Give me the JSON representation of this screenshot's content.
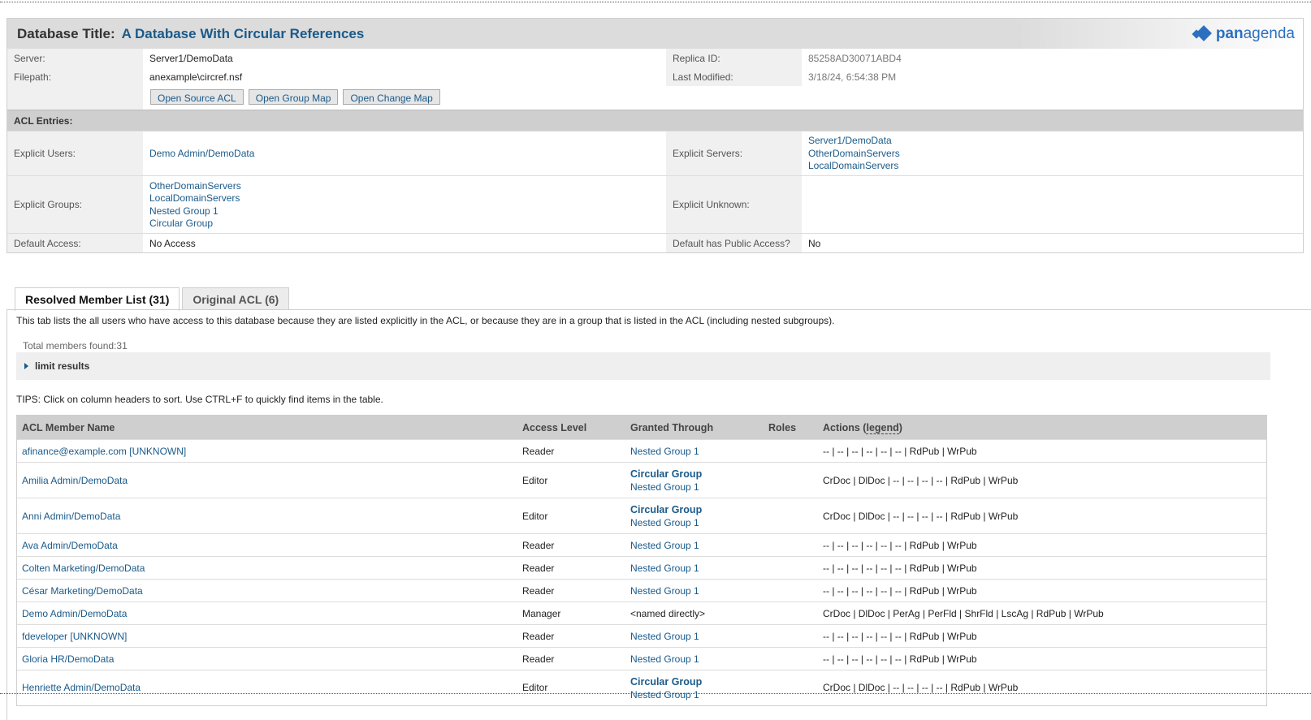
{
  "header": {
    "title_label": "Database Title:",
    "title_value": "A Database With Circular References",
    "logo_bold": "pan",
    "logo_light": "agenda"
  },
  "info": {
    "server_label": "Server:",
    "server_value": "Server1/DemoData",
    "filepath_label": "Filepath:",
    "filepath_value": "anexample\\circref.nsf",
    "replica_label": "Replica ID:",
    "replica_value": "85258AD30071ABD4",
    "modified_label": "Last Modified:",
    "modified_value": "3/18/24, 6:54:38 PM"
  },
  "buttons": {
    "open_source_acl": "Open Source ACL",
    "open_group_map": "Open Group Map",
    "open_change_map": "Open Change Map"
  },
  "acl": {
    "header": "ACL Entries:",
    "explicit_users_label": "Explicit Users:",
    "explicit_users": [
      "Demo Admin/DemoData"
    ],
    "explicit_servers_label": "Explicit Servers:",
    "explicit_servers": [
      "Server1/DemoData",
      "OtherDomainServers",
      "LocalDomainServers"
    ],
    "explicit_groups_label": "Explicit Groups:",
    "explicit_groups": [
      "OtherDomainServers",
      "LocalDomainServers",
      "Nested Group 1",
      "Circular Group"
    ],
    "explicit_unknown_label": "Explicit Unknown:",
    "default_access_label": "Default Access:",
    "default_access_value": "No Access",
    "default_public_label": "Default has Public Access?",
    "default_public_value": "No"
  },
  "tabs": [
    {
      "label": "Resolved Member List (31)",
      "active": true
    },
    {
      "label": "Original ACL (6)",
      "active": false
    }
  ],
  "resolved": {
    "description": "This tab lists the all users who have access to this database because they are listed explicitly in the ACL, or because they are in a group that is listed in the ACL (including nested subgroups).",
    "total": "Total members found:31",
    "limit_label": "limit results",
    "tips": "TIPS: Click on column headers to sort. Use CTRL+F to quickly find items in the table."
  },
  "table": {
    "headers": {
      "name": "ACL Member Name",
      "access": "Access Level",
      "granted": "Granted Through",
      "roles": "Roles",
      "actions_prefix": "Actions (",
      "actions_legend": "legend",
      "actions_suffix": ")"
    },
    "rows": [
      {
        "name": "afinance@example.com [UNKNOWN]",
        "access": "Reader",
        "granted_bold": "",
        "granted": "Nested Group 1",
        "actions": "-- | -- | -- | -- | -- | -- | RdPub | WrPub"
      },
      {
        "name": "Amilia Admin/DemoData",
        "access": "Editor",
        "granted_bold": "Circular Group",
        "granted": "Nested Group 1",
        "actions": "CrDoc | DlDoc | -- | -- | -- | -- | RdPub | WrPub"
      },
      {
        "name": "Anni Admin/DemoData",
        "access": "Editor",
        "granted_bold": "Circular Group",
        "granted": "Nested Group 1",
        "actions": "CrDoc | DlDoc | -- | -- | -- | -- | RdPub | WrPub"
      },
      {
        "name": "Ava Admin/DemoData",
        "access": "Reader",
        "granted_bold": "",
        "granted": "Nested Group 1",
        "actions": "-- | -- | -- | -- | -- | -- | RdPub | WrPub"
      },
      {
        "name": "Colten Marketing/DemoData",
        "access": "Reader",
        "granted_bold": "",
        "granted": "Nested Group 1",
        "actions": "-- | -- | -- | -- | -- | -- | RdPub | WrPub"
      },
      {
        "name": "César Marketing/DemoData",
        "access": "Reader",
        "granted_bold": "",
        "granted": "Nested Group 1",
        "actions": "-- | -- | -- | -- | -- | -- | RdPub | WrPub"
      },
      {
        "name": "Demo Admin/DemoData",
        "access": "Manager",
        "granted_bold": "",
        "granted": "<named directly>",
        "actions": "CrDoc | DlDoc | PerAg | PerFld | ShrFld | LscAg | RdPub | WrPub"
      },
      {
        "name": "fdeveloper [UNKNOWN]",
        "access": "Reader",
        "granted_bold": "",
        "granted": "Nested Group 1",
        "actions": "-- | -- | -- | -- | -- | -- | RdPub | WrPub"
      },
      {
        "name": "Gloria HR/DemoData",
        "access": "Reader",
        "granted_bold": "",
        "granted": "Nested Group 1",
        "actions": "-- | -- | -- | -- | -- | -- | RdPub | WrPub"
      },
      {
        "name": "Henriette Admin/DemoData",
        "access": "Editor",
        "granted_bold": "Circular Group",
        "granted": "Nested Group 1",
        "actions": "CrDoc | DlDoc | -- | -- | -- | -- | RdPub | WrPub"
      }
    ]
  }
}
